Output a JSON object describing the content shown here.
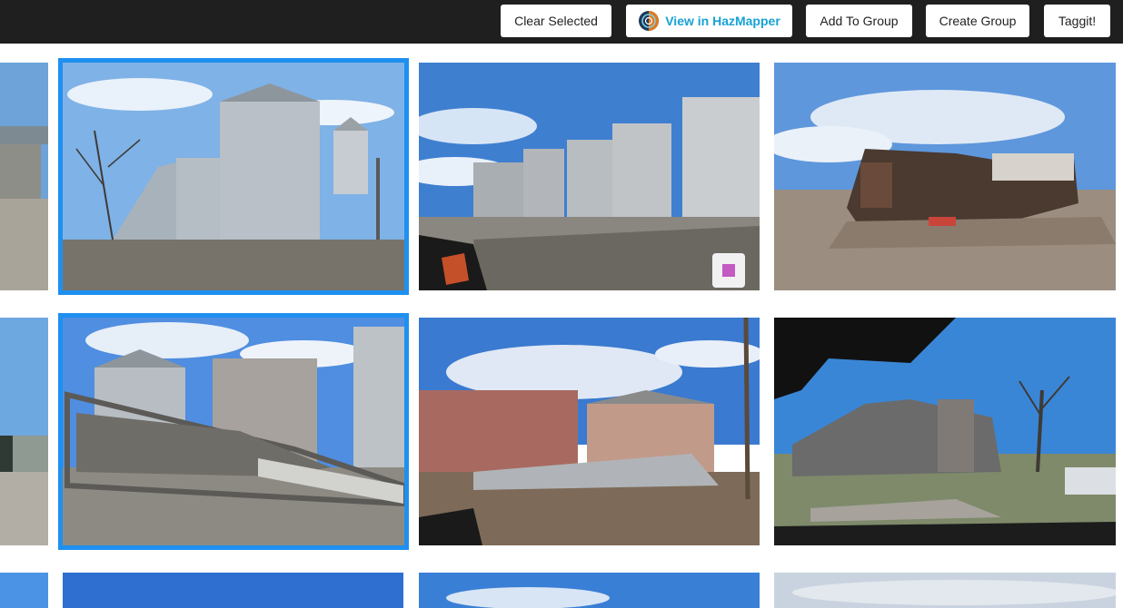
{
  "toolbar": {
    "clear_label": "Clear Selected",
    "hazmapper_label": "View in HazMapper",
    "add_group_label": "Add To Group",
    "create_group_label": "Create Group",
    "taggit_label": "Taggit!"
  },
  "colors": {
    "topbar": "#1f1f1f",
    "accent": "#1e90f0",
    "hazmapper_text": "#17a2d4",
    "select_marker": "#c35bc3"
  },
  "gallery": {
    "photos": [
      {
        "id": "r1c0",
        "selected": false,
        "icon": "partial-photo"
      },
      {
        "id": "r1c1",
        "selected": true,
        "icon": "grain-bins-photo"
      },
      {
        "id": "r1c2",
        "selected": false,
        "icon": "silos-from-car-photo"
      },
      {
        "id": "r1c3",
        "selected": false,
        "icon": "destroyed-house-photo"
      },
      {
        "id": "r2c0",
        "selected": false,
        "icon": "partial-photo"
      },
      {
        "id": "r2c1",
        "selected": true,
        "icon": "collapsed-structure-photo"
      },
      {
        "id": "r2c2",
        "selected": false,
        "icon": "damaged-buildings-photo"
      },
      {
        "id": "r2c3",
        "selected": false,
        "icon": "damaged-house-windshield-photo"
      }
    ]
  }
}
